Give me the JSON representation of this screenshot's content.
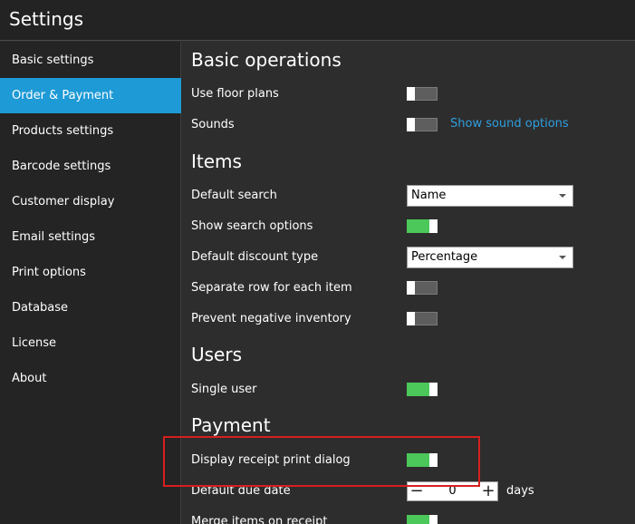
{
  "window": {
    "title": "Settings"
  },
  "sidebar": {
    "items": [
      {
        "label": "Basic settings",
        "active": false
      },
      {
        "label": "Order & Payment",
        "active": true
      },
      {
        "label": "Products settings",
        "active": false
      },
      {
        "label": "Barcode settings",
        "active": false
      },
      {
        "label": "Customer display",
        "active": false
      },
      {
        "label": "Email settings",
        "active": false
      },
      {
        "label": "Print options",
        "active": false
      },
      {
        "label": "Database",
        "active": false
      },
      {
        "label": "License",
        "active": false
      },
      {
        "label": "About",
        "active": false
      }
    ]
  },
  "sections": {
    "basic_operations": {
      "title": "Basic operations",
      "use_floor_plans": {
        "label": "Use floor plans",
        "enabled": false
      },
      "sounds": {
        "label": "Sounds",
        "enabled": false,
        "link": "Show sound options"
      }
    },
    "items": {
      "title": "Items",
      "default_search": {
        "label": "Default search",
        "value": "Name"
      },
      "show_search_options": {
        "label": "Show search options",
        "enabled": true
      },
      "default_discount_type": {
        "label": "Default discount type",
        "value": "Percentage"
      },
      "separate_row": {
        "label": "Separate row for each item",
        "enabled": false
      },
      "prevent_negative_inventory": {
        "label": "Prevent negative inventory",
        "enabled": false
      }
    },
    "users": {
      "title": "Users",
      "single_user": {
        "label": "Single user",
        "enabled": true
      }
    },
    "payment": {
      "title": "Payment",
      "display_receipt_print_dialog": {
        "label": "Display receipt print dialog",
        "enabled": true
      },
      "default_due_date": {
        "label": "Default due date",
        "value": "0",
        "minus": "−",
        "plus": "+",
        "unit": "days"
      },
      "merge_items_on_receipt": {
        "label": "Merge items on receipt",
        "enabled": true
      }
    }
  },
  "colors": {
    "accent": "#1e9ad6",
    "toggle_on": "#4cc75a",
    "toggle_off": "#5e5e5e",
    "link": "#2e9ee0",
    "highlight": "#d61f1f"
  }
}
